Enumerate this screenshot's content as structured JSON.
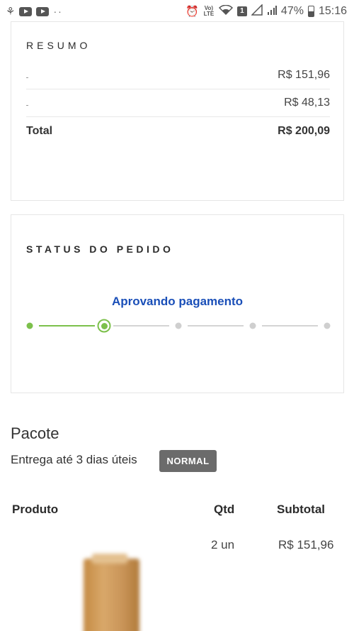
{
  "status_bar": {
    "signal_text": "47%",
    "time": "15:16",
    "volte_label": "Vo) LTE",
    "sim_label": "1"
  },
  "summary": {
    "title": "RESUMO",
    "rows": [
      {
        "label": "",
        "value": "R$ 151,96"
      },
      {
        "label": "",
        "value": "R$ 48,13"
      },
      {
        "label": "Total",
        "value": "R$ 200,09"
      }
    ]
  },
  "order_status": {
    "title": "STATUS DO PEDIDO",
    "current_label": "Aprovando pagamento",
    "steps": [
      "done",
      "current",
      "pending",
      "pending",
      "pending"
    ],
    "accent_color": "#7cc04b",
    "label_color": "#1a4fb8"
  },
  "package": {
    "title": "Pacote",
    "delivery_text": "Entrega até 3 dias úteis",
    "badge": "NORMAL",
    "table": {
      "headers": {
        "product": "Produto",
        "qty": "Qtd",
        "subtotal": "Subtotal"
      },
      "rows": [
        {
          "qty": "2 un",
          "subtotal": "R$ 151,96"
        }
      ]
    }
  }
}
